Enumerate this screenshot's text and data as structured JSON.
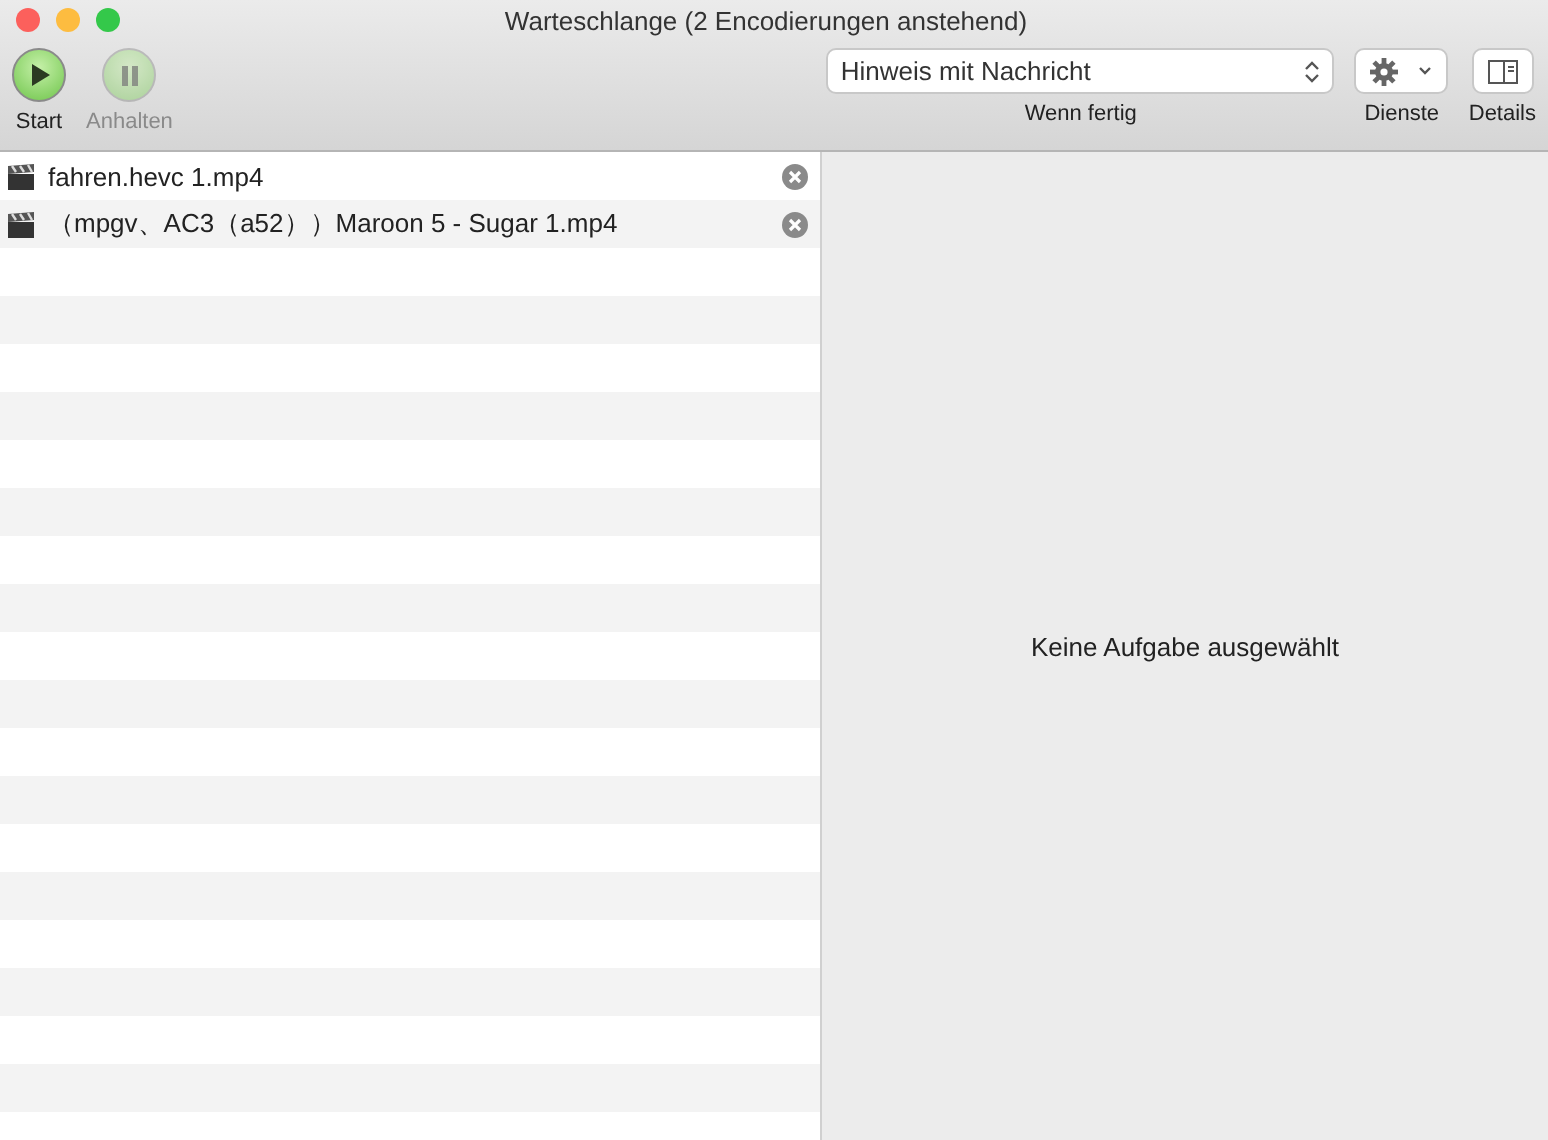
{
  "window": {
    "title": "Warteschlange (2 Encodierungen anstehend)"
  },
  "toolbar": {
    "buttons": [
      {
        "kind": "play",
        "label": "Start",
        "disabled": false
      },
      {
        "kind": "pause",
        "label": "Anhalten",
        "disabled": true
      }
    ],
    "when_done": {
      "value": "Hinweis mit Nachricht",
      "label": "Wenn fertig"
    },
    "services": {
      "label": "Dienste"
    },
    "details": {
      "label": "Details"
    }
  },
  "queue": [
    {
      "name": "fahren.hevc 1.mp4"
    },
    {
      "name": "（mpgv、AC3（a52））Maroon 5 - Sugar 1.mp4"
    }
  ],
  "detail_pane": {
    "message": "Keine Aufgabe ausgewählt"
  }
}
